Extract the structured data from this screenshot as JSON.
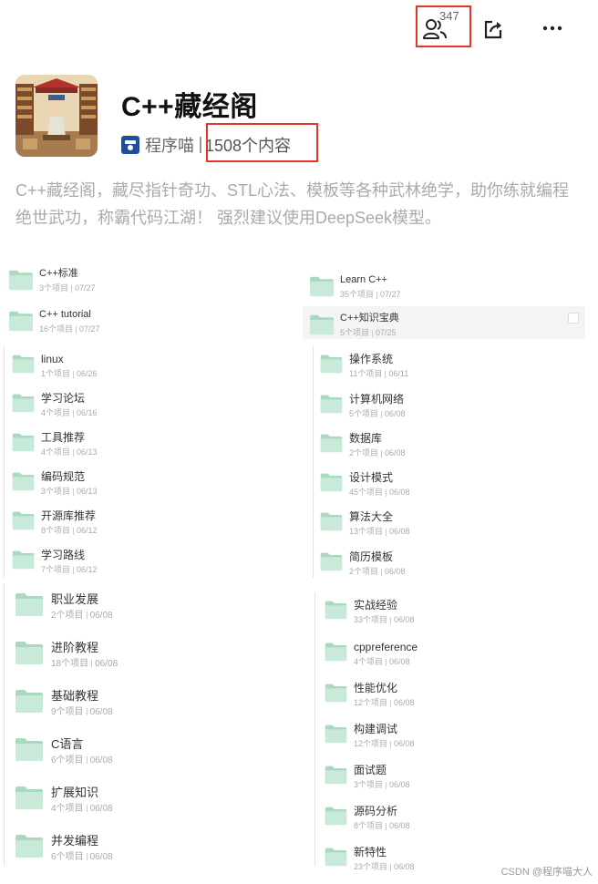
{
  "header": {
    "members_count": "347",
    "icons": [
      "members-icon",
      "share-icon",
      "more-icon"
    ]
  },
  "profile": {
    "title": "C++藏经阁",
    "author": "程序喵",
    "content_count": "1508个内容",
    "description": "C++藏经阁，藏尽指针奇功、STL心法、模板等各种武林绝学，助你练就编程绝世武功，称霸代码江湖！ 强烈建议使用DeepSeek模型。"
  },
  "folders": {
    "top_left": [
      {
        "name": "C++标准",
        "count": "3个项目",
        "date": "07/27"
      },
      {
        "name": "C++ tutorial",
        "count": "16个项目",
        "date": "07/27"
      }
    ],
    "top_right": [
      {
        "name": "Learn C++",
        "count": "35个项目",
        "date": "07/27"
      },
      {
        "name": "C++知识宝典",
        "count": "5个项目",
        "date": "07/25"
      }
    ],
    "mid_left": [
      {
        "name": "linux",
        "count": "1个项目",
        "date": "06/26"
      },
      {
        "name": "学习论坛",
        "count": "4个项目",
        "date": "06/16"
      },
      {
        "name": "工具推荐",
        "count": "4个项目",
        "date": "06/13"
      },
      {
        "name": "编码规范",
        "count": "3个项目",
        "date": "06/13"
      },
      {
        "name": "开源库推荐",
        "count": "8个项目",
        "date": "06/12"
      },
      {
        "name": "学习路线",
        "count": "7个项目",
        "date": "06/12"
      }
    ],
    "mid_right": [
      {
        "name": "操作系统",
        "count": "11个项目",
        "date": "06/11"
      },
      {
        "name": "计算机网络",
        "count": "5个项目",
        "date": "06/08"
      },
      {
        "name": "数据库",
        "count": "2个项目",
        "date": "06/08"
      },
      {
        "name": "设计模式",
        "count": "45个项目",
        "date": "06/08"
      },
      {
        "name": "算法大全",
        "count": "13个项目",
        "date": "06/08"
      },
      {
        "name": "简历模板",
        "count": "2个项目",
        "date": "06/08"
      }
    ],
    "bottom_left": [
      {
        "name": "职业发展",
        "count": "2个项目",
        "date": "06/08"
      },
      {
        "name": "进阶教程",
        "count": "18个项目",
        "date": "06/08"
      },
      {
        "name": "基础教程",
        "count": "9个项目",
        "date": "06/08"
      },
      {
        "name": "C语言",
        "count": "6个项目",
        "date": "06/08"
      },
      {
        "name": "扩展知识",
        "count": "4个项目",
        "date": "06/08"
      },
      {
        "name": "并发编程",
        "count": "6个项目",
        "date": "06/08"
      }
    ],
    "bottom_right": [
      {
        "name": "实战经验",
        "count": "33个项目",
        "date": "06/08"
      },
      {
        "name": "cppreference",
        "count": "4个项目",
        "date": "06/08"
      },
      {
        "name": "性能优化",
        "count": "12个项目",
        "date": "06/08"
      },
      {
        "name": "构建调试",
        "count": "12个项目",
        "date": "06/08"
      },
      {
        "name": "面试题",
        "count": "3个项目",
        "date": "06/08"
      },
      {
        "name": "源码分析",
        "count": "8个项目",
        "date": "06/08"
      },
      {
        "name": "新特性",
        "count": "23个项目",
        "date": "06/08"
      }
    ]
  },
  "watermark": "CSDN @程序喵大人",
  "colors": {
    "accent_red": "#e8332a",
    "folder_green": "#c9ead9",
    "folder_green_dark": "#a9d9bf"
  }
}
